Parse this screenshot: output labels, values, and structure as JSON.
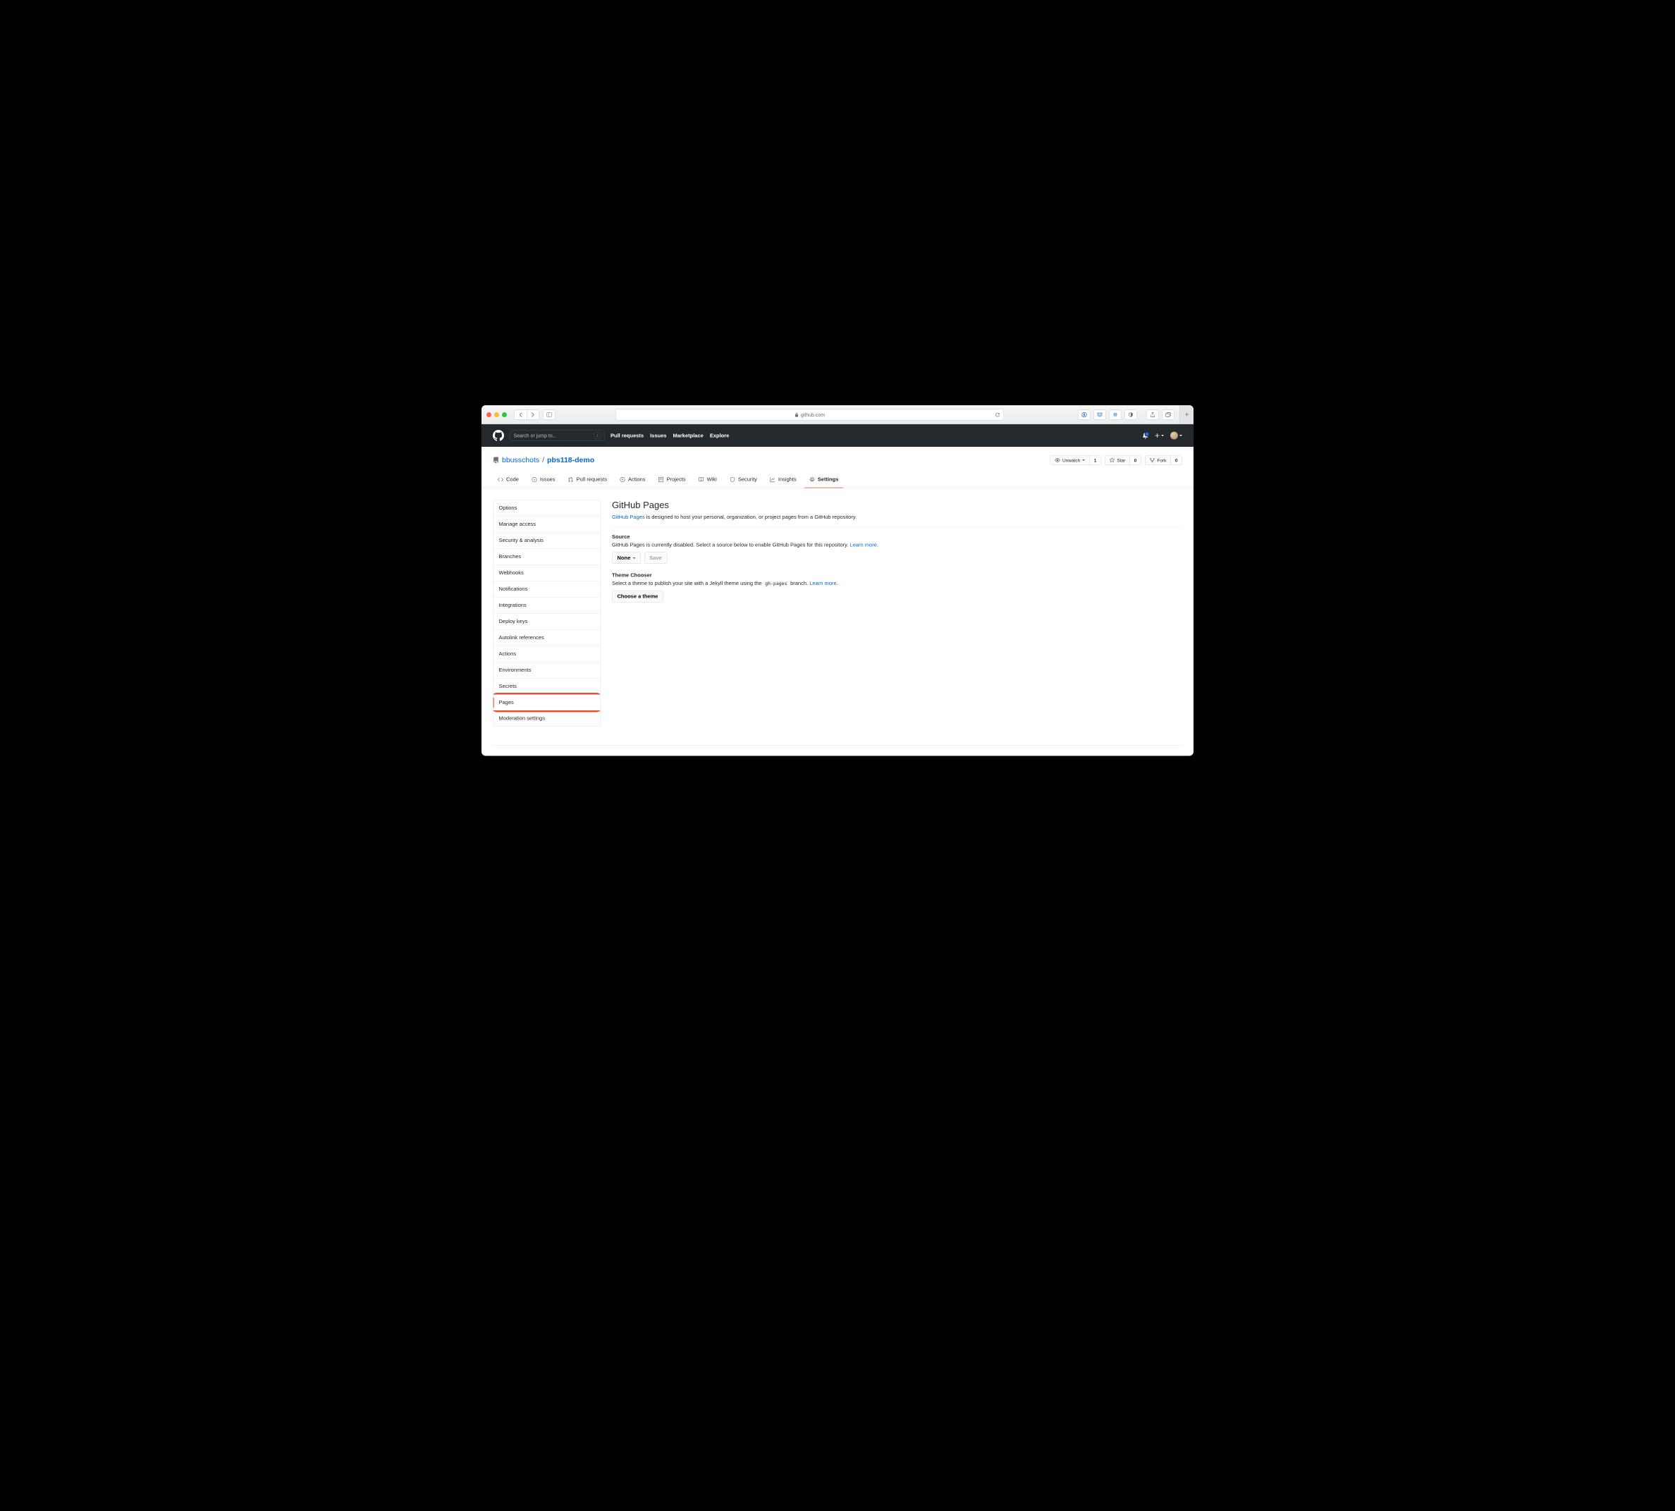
{
  "browser": {
    "domain": "github.com"
  },
  "header": {
    "search_placeholder": "Search or jump to...",
    "slash": "/",
    "nav": [
      "Pull requests",
      "Issues",
      "Marketplace",
      "Explore"
    ]
  },
  "repo": {
    "owner": "bbusschots",
    "sep": "/",
    "name": "pbs118-demo",
    "unwatch": "Unwatch",
    "unwatch_count": "1",
    "star": "Star",
    "star_count": "0",
    "fork": "Fork",
    "fork_count": "0"
  },
  "tabs": [
    "Code",
    "Issues",
    "Pull requests",
    "Actions",
    "Projects",
    "Wiki",
    "Security",
    "Insights",
    "Settings"
  ],
  "sidebar": {
    "items": [
      "Options",
      "Manage access",
      "Security & analysis",
      "Branches",
      "Webhooks",
      "Notifications",
      "Integrations",
      "Deploy keys",
      "Autolink references",
      "Actions",
      "Environments",
      "Secrets",
      "Pages",
      "Moderation settings"
    ]
  },
  "main": {
    "title": "GitHub Pages",
    "lead_link": "GitHub Pages",
    "lead_text": " is designed to host your personal, organization, or project pages from a GitHub repository.",
    "source_h": "Source",
    "source_text": "GitHub Pages is currently disabled. Select a source below to enable GitHub Pages for this repository. ",
    "learn_more": "Learn more",
    "period": ".",
    "none_btn": "None",
    "save_btn": "Save",
    "theme_h": "Theme Chooser",
    "theme_text_a": "Select a theme to publish your site with a Jekyll theme using the ",
    "theme_code": "gh-pages",
    "theme_text_b": " branch. ",
    "choose_btn": "Choose a theme"
  }
}
